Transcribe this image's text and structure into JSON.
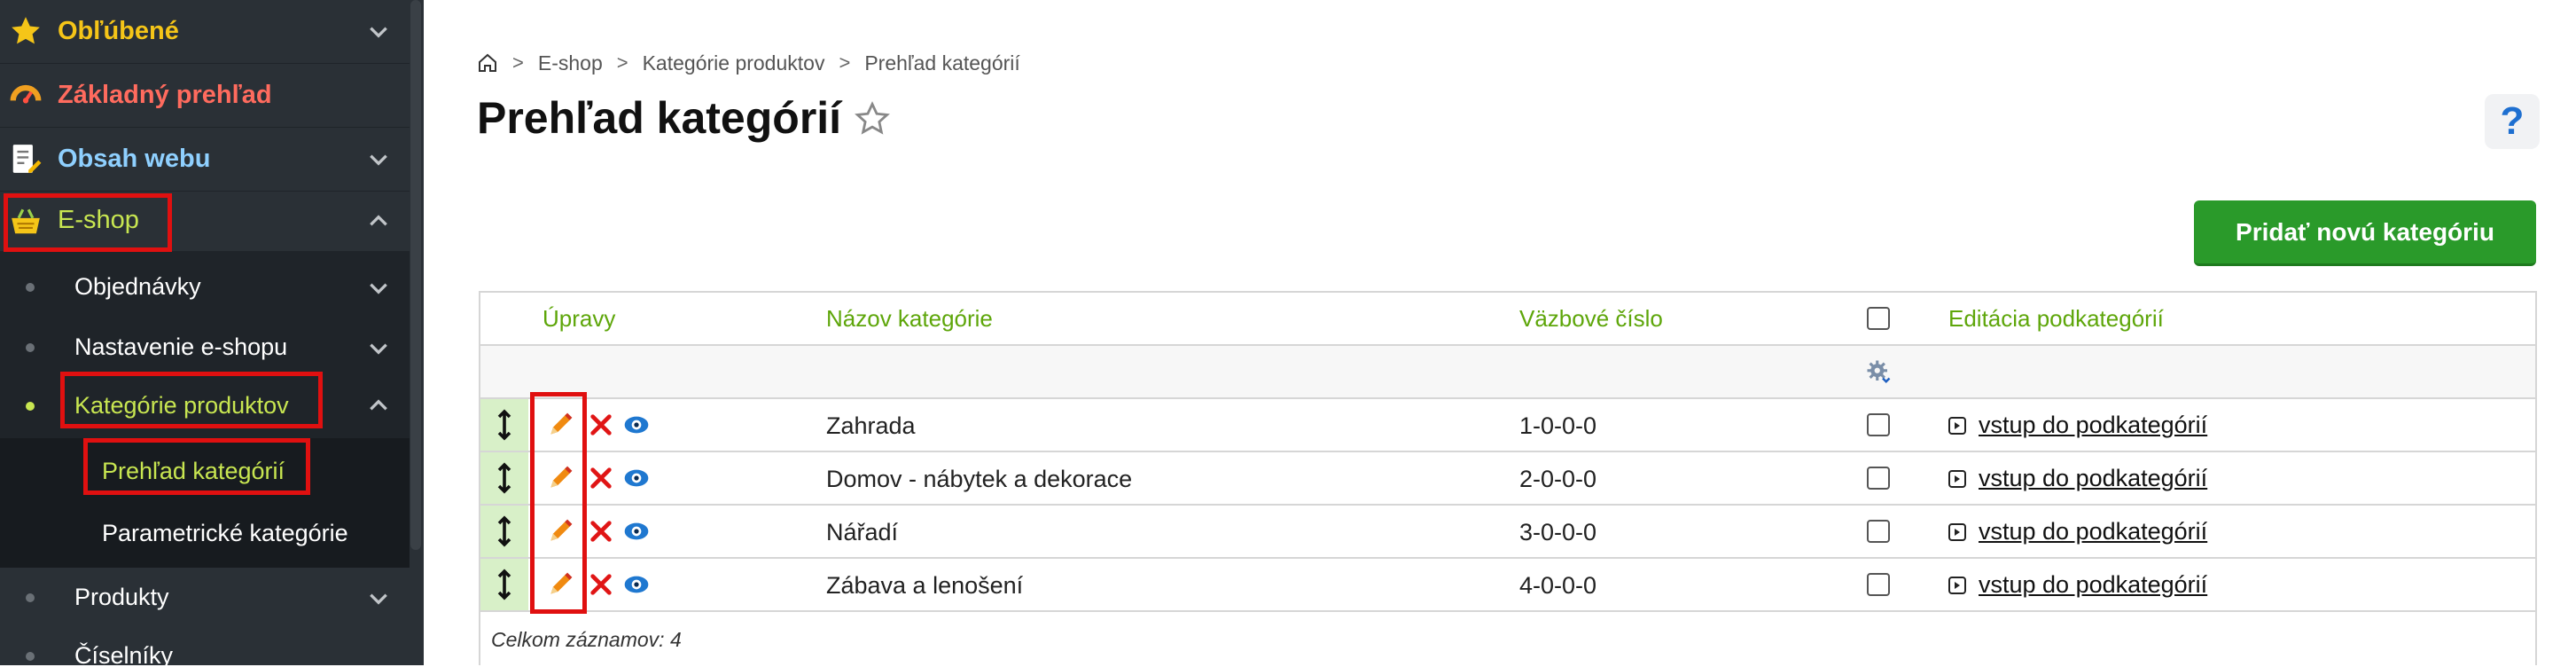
{
  "sidebar": {
    "items": [
      {
        "label": "Obľúbené",
        "icon": "star-icon",
        "color": "#f5c518"
      },
      {
        "label": "Základný prehľad",
        "icon": "speedometer-icon",
        "color": "#ff6b5e"
      },
      {
        "label": "Obsah webu",
        "icon": "document-edit-icon",
        "color": "#8fd0ff"
      },
      {
        "label": "E-shop",
        "icon": "basket-icon",
        "color": "#c8e651"
      }
    ],
    "eshop_sub": [
      {
        "label": "Objednávky"
      },
      {
        "label": "Nastavenie e-shopu"
      },
      {
        "label": "Kategórie produktov",
        "active": true,
        "color": "#c8e651"
      },
      {
        "label": "Produkty"
      },
      {
        "label": "Číselníky"
      }
    ],
    "category_sub": [
      {
        "label": "Prehľad kategórií",
        "active": true,
        "color": "#c8e651"
      },
      {
        "label": "Parametrické kategórie"
      }
    ]
  },
  "breadcrumb": {
    "items": [
      "E-shop",
      "Kategórie produktov",
      "Prehľad kategórií"
    ],
    "separator": ">"
  },
  "page": {
    "title": "Prehľad kategórií",
    "help_label": "?",
    "add_button": "Pridať novú kategóriu"
  },
  "table": {
    "headers": {
      "edits": "Úpravy",
      "name": "Názov kategórie",
      "ref": "Väzbové číslo",
      "sub": "Editácia podkategórií"
    },
    "rows": [
      {
        "name": "Zahrada",
        "ref": "1-0-0-0",
        "link": "vstup do podkategórií"
      },
      {
        "name": "Domov - nábytek a dekorace",
        "ref": "2-0-0-0",
        "link": "vstup do podkategórií"
      },
      {
        "name": "Nářadí",
        "ref": "3-0-0-0",
        "link": "vstup do podkategórií"
      },
      {
        "name": "Zábava a lenošení",
        "ref": "4-0-0-0",
        "link": "vstup do podkategórií"
      }
    ],
    "footer": "Celkom záznamov: 4"
  },
  "colors": {
    "accent_green": "#5ea60a",
    "button_green": "#2a9a2a",
    "highlight_red": "#e01010",
    "sidebar_bg": "#2a3036"
  }
}
